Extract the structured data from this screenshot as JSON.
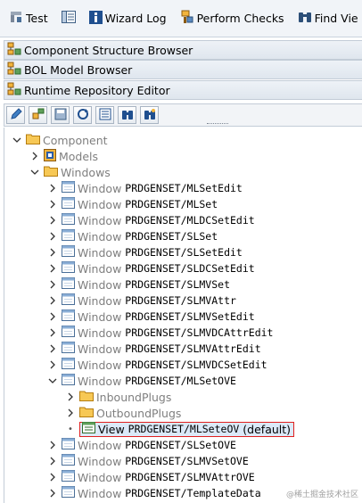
{
  "toolbar": {
    "items": [
      {
        "label": "Test",
        "icon": "tool-icon"
      },
      {
        "label": "",
        "icon": "layout-icon"
      },
      {
        "label": "Wizard Log",
        "icon": "info-icon"
      },
      {
        "label": "Perform Checks",
        "icon": "checks-icon"
      },
      {
        "label": "Find Vie",
        "icon": "binoculars-icon"
      }
    ]
  },
  "panels": [
    {
      "label": "Component Structure Browser"
    },
    {
      "label": "BOL Model Browser"
    },
    {
      "label": "Runtime Repository Editor"
    }
  ],
  "icon_bar": [
    "edit-icon",
    "assign-icon",
    "save-icon",
    "refresh-icon",
    "list-icon",
    "search-icon",
    "search-details-icon"
  ],
  "tree": {
    "component": "Component",
    "models": "Models",
    "windows": "Windows",
    "window_prefix": "Window",
    "windows_list": [
      "PRDGENSET/MLSetEdit",
      "PRDGENSET/MLSet",
      "PRDGENSET/MLDCSetEdit",
      "PRDGENSET/SLSet",
      "PRDGENSET/SLSetEdit",
      "PRDGENSET/SLDCSetEdit",
      "PRDGENSET/SLMVSet",
      "PRDGENSET/SLMVAttr",
      "PRDGENSET/SLMVSetEdit",
      "PRDGENSET/SLMVDCAttrEdit",
      "PRDGENSET/SLMVAttrEdit",
      "PRDGENSET/SLMVDCSetEdit",
      "PRDGENSET/MLSetOVE"
    ],
    "inbound": "InboundPlugs",
    "outbound": "OutboundPlugs",
    "view_prefix": "View",
    "view_name": "PRDGENSET/MLSeteOV",
    "view_suffix": "(default)",
    "windows_after": [
      "PRDGENSET/SLSetOVE",
      "PRDGENSET/SLMVSetOVE",
      "PRDGENSET/SLMVAttrOVE",
      "PRDGENSET/TemplateData"
    ]
  },
  "watermark": "@稀土掘金技术社区",
  "colors": {
    "folder": "#f2b43c",
    "window_icon_border": "#4a6f98",
    "selection_border": "#e02020"
  }
}
